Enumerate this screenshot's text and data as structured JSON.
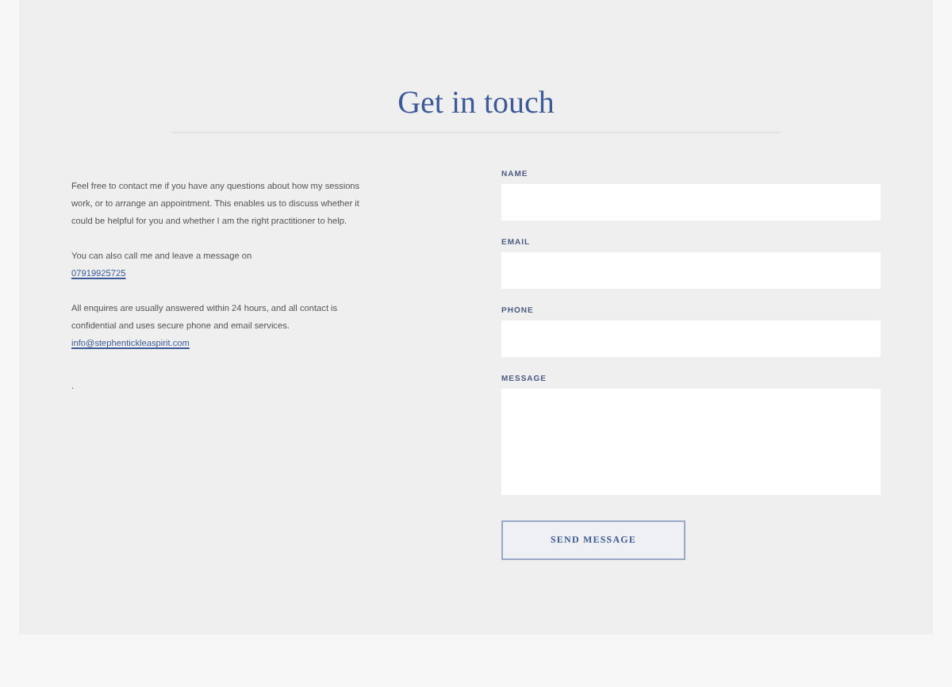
{
  "title": "Get in touch",
  "intro": [
    "Feel free to contact me if you have any questions about how my sessions work, or to arrange an appointment. This enables us to discuss whether it could be helpful for you and whether I am the right practitioner to help.",
    "You can also call me and leave a message on"
  ],
  "phone": "07919925725",
  "note": "All enquires are usually answered within 24 hours, and all contact is confidential and uses secure phone and email services.",
  "email": "info@stephentickleaspirit.com",
  "dot": ".",
  "fields": [
    {
      "label": "NAME",
      "kind": "input"
    },
    {
      "label": "EMAIL",
      "kind": "input"
    },
    {
      "label": "PHONE",
      "kind": "input"
    },
    {
      "label": "MESSAGE",
      "kind": "textarea"
    }
  ],
  "button": "SEND MESSAGE"
}
